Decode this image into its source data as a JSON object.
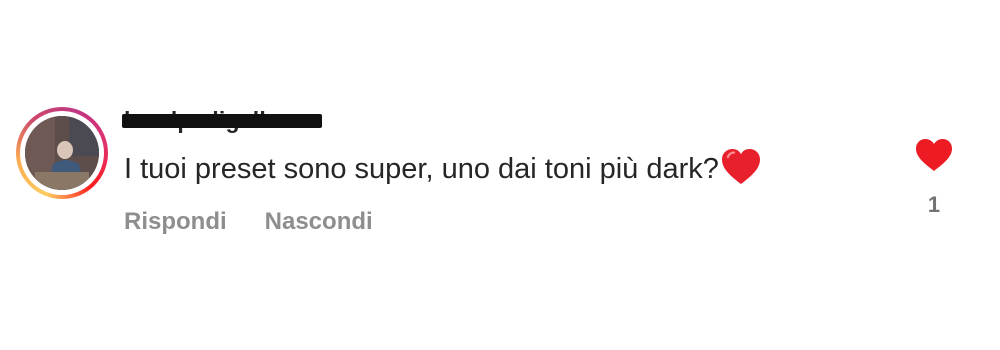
{
  "comment": {
    "username": "lavolpedigalla",
    "text": "I tuoi preset sono super, uno dai toni più dark?",
    "emoji": "red-heart-emoji",
    "actions": {
      "reply_label": "Rispondi",
      "hide_label": "Nascondi"
    },
    "like": {
      "icon": "heart-icon",
      "liked": true,
      "count": "1"
    }
  },
  "colors": {
    "text": "#262626",
    "muted": "#8e8e8e",
    "like_red": "#ed1c24"
  }
}
